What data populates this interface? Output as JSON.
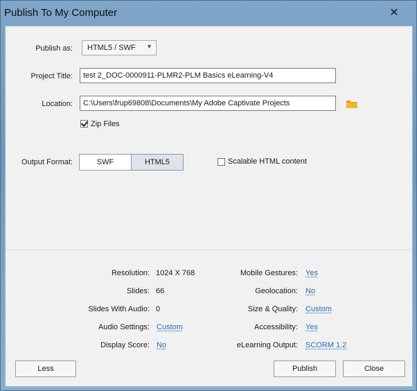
{
  "window": {
    "title": "Publish To My Computer",
    "close_glyph": "✕"
  },
  "form": {
    "publish_as_label": "Publish as:",
    "publish_as_value": "HTML5 / SWF",
    "project_title_label": "Project Title:",
    "project_title_value": "test 2_DOC-0000911-PLMR2-PLM Basics eLearning-V4",
    "location_label": "Location:",
    "location_value": "C:\\Users\\frup69808\\Documents\\My Adobe Captivate Projects",
    "zip_files_label": "Zip Files",
    "zip_files_checked": true,
    "output_format_label": "Output Format:",
    "output_swf": "SWF",
    "output_html5": "HTML5",
    "scalable_label": "Scalable HTML content",
    "scalable_checked": false
  },
  "summary": {
    "resolution_label": "Resolution:",
    "resolution_value": "1024 X 768",
    "slides_label": "Slides:",
    "slides_value": "66",
    "slides_audio_label": "Slides With Audio:",
    "slides_audio_value": "0",
    "audio_settings_label": "Audio Settings:",
    "audio_settings_value": "Custom",
    "display_score_label": "Display Score:",
    "display_score_value": "No",
    "mobile_gestures_label": "Mobile Gestures:",
    "mobile_gestures_value": "Yes",
    "geolocation_label": "Geolocation:",
    "geolocation_value": "No",
    "size_quality_label": "Size & Quality:",
    "size_quality_value": "Custom",
    "accessibility_label": "Accessibility:",
    "accessibility_value": "Yes",
    "elearning_output_label": "eLearning Output:",
    "elearning_output_value": "SCORM 1.2"
  },
  "buttons": {
    "less": "Less",
    "publish": "Publish",
    "close": "Close"
  },
  "colors": {
    "link": "#1f6db3",
    "folder": "#e2a21a"
  }
}
